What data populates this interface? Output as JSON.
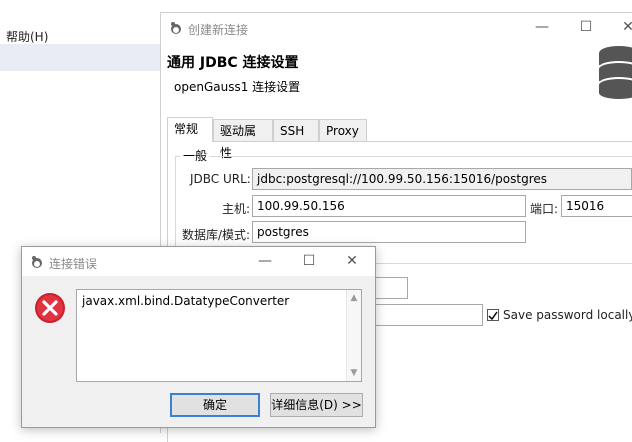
{
  "background": {
    "menu_help": "帮助(H)"
  },
  "conn_window": {
    "title": "创建新连接",
    "controls": {
      "minimize": "—",
      "maximize": "☐",
      "close": "✕"
    },
    "header_title": "通用 JDBC 连接设置",
    "header_subtitle": "openGauss1 连接设置",
    "tabs": [
      "常规",
      "驱动属性",
      "SSH",
      "Proxy"
    ],
    "group_general": "一般",
    "jdbc_url_label": "JDBC URL:",
    "jdbc_url_value": "jdbc:postgresql://100.99.50.156:15016/postgres",
    "host_label": "主机:",
    "host_value": "100.99.50.156",
    "port_label": "端口:",
    "port_value": "15016",
    "database_label": "数据库/模式:",
    "database_value": "postgres",
    "save_password_label": "Save password locally",
    "save_password_checked": true
  },
  "error_dialog": {
    "title": "连接错误",
    "controls": {
      "minimize": "—",
      "maximize": "☐",
      "close": "✕"
    },
    "message": "javax.xml.bind.DatatypeConverter",
    "ok_label": "确定",
    "details_label": "详细信息(D) >>"
  }
}
